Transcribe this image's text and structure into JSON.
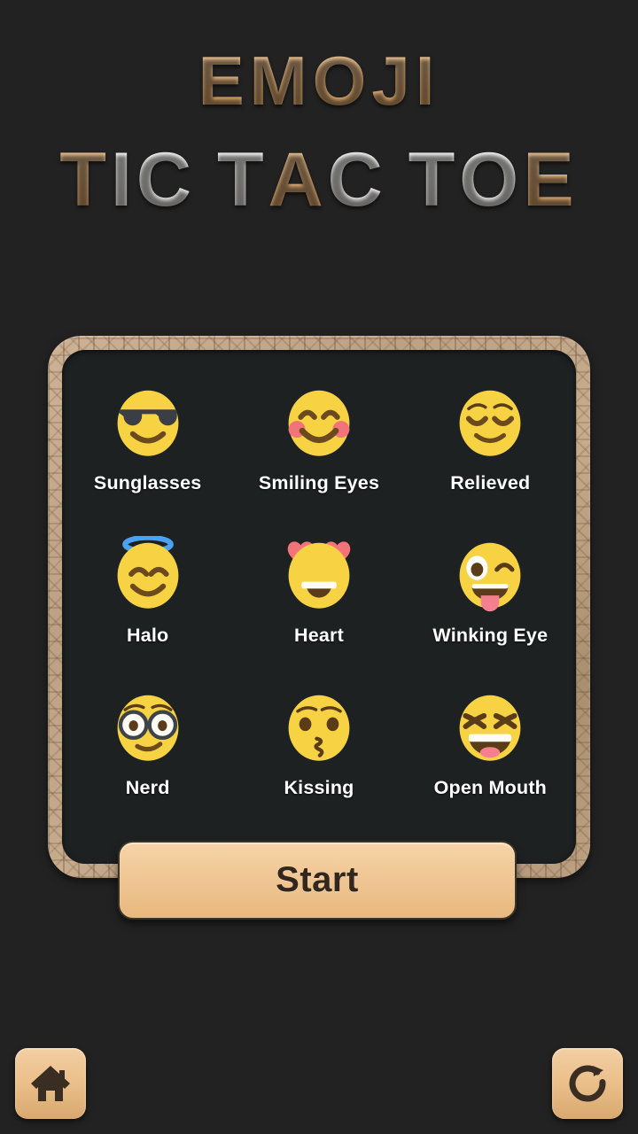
{
  "app": {
    "title_line_1": "EMOJI",
    "title_line_2": "TIC TAC TOE",
    "background_color": "#222222",
    "accent_gold": "#e6b784",
    "panel_color": "#1e2122",
    "title_line_1_colors": [
      "gold",
      "gold",
      "gold",
      "gold",
      "gold"
    ],
    "title_line_2_colors": [
      "gold",
      "white",
      "white",
      "space",
      "white",
      "gold",
      "white",
      "space",
      "white",
      "white",
      "gold"
    ]
  },
  "board": {
    "frame_color": "#bda183",
    "emoji_options": [
      {
        "id": "sunglasses",
        "label": "Sunglasses",
        "glyph": "sunglasses-emoji"
      },
      {
        "id": "smiling-eyes",
        "label": "Smiling Eyes",
        "glyph": "smiling-eyes-emoji"
      },
      {
        "id": "relieved",
        "label": "Relieved",
        "glyph": "relieved-emoji"
      },
      {
        "id": "halo",
        "label": "Halo",
        "glyph": "halo-emoji"
      },
      {
        "id": "heart",
        "label": "Heart",
        "glyph": "heart-eyes-emoji"
      },
      {
        "id": "winking-eye",
        "label": "Winking Eye",
        "glyph": "winking-tongue-emoji"
      },
      {
        "id": "nerd",
        "label": "Nerd",
        "glyph": "nerd-emoji"
      },
      {
        "id": "kissing",
        "label": "Kissing",
        "glyph": "kissing-emoji"
      },
      {
        "id": "open-mouth",
        "label": "Open Mouth",
        "glyph": "open-mouth-emoji"
      }
    ]
  },
  "start_button": {
    "label": "Start",
    "color": "#f0c795",
    "text_color": "#33271d"
  },
  "bottom_bar": {
    "home": {
      "label": "",
      "icon": "home-icon",
      "color": "#e9bd88"
    },
    "reload": {
      "label": "",
      "icon": "reload-icon",
      "color": "#e9bd88"
    }
  }
}
